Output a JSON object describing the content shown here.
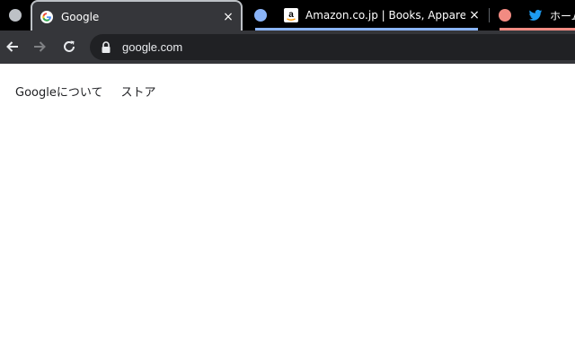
{
  "browser": {
    "tabs": [
      {
        "title": "Google",
        "active": true,
        "close_glyph": "×",
        "favicon": "google-favicon"
      },
      {
        "title": "Amazon.co.jp | Books, Apparel, El",
        "active": false,
        "close_glyph": "×",
        "favicon": "amazon-favicon",
        "group_color": "#8ab4f8"
      },
      {
        "title": "ホーム",
        "active": false,
        "favicon": "twitter-favicon",
        "group_color": "#f28b82"
      }
    ],
    "first_group_color": "#bdc1c6",
    "address": "google.com"
  },
  "page": {
    "nav_links": [
      {
        "label": "Googleについて"
      },
      {
        "label": "ストア"
      }
    ]
  },
  "colors": {
    "tabstrip_bg": "#000000",
    "toolbar_bg": "#35363a",
    "omnibox_bg": "#202124",
    "twitter_blue": "#1d9bf0",
    "amazon_orange": "#ff9900"
  }
}
